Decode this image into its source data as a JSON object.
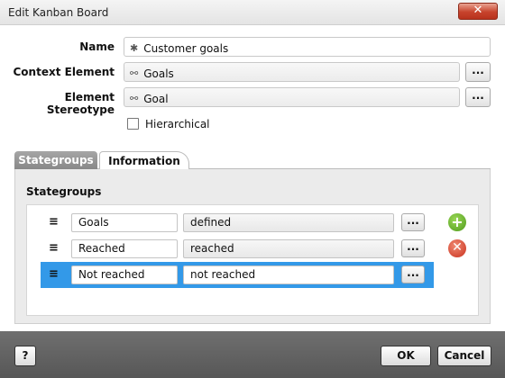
{
  "window": {
    "title": "Edit Kanban Board",
    "close_label": "✕"
  },
  "form": {
    "name_label": "Name",
    "name_value": "Customer goals",
    "name_icon": "asterisk-icon",
    "context_label": "Context Element",
    "context_value": "Goals",
    "stereotype_label": "Element Stereotype",
    "stereotype_value": "Goal",
    "link_icon": "link-icon",
    "browse_label": "...",
    "hierarchical_label": "Hierarchical",
    "hierarchical_checked": false
  },
  "tabs": [
    {
      "label": "Stategroups",
      "active": true
    },
    {
      "label": "Information",
      "active": false
    }
  ],
  "stategroups": {
    "title": "Stategroups",
    "rows": [
      {
        "name": "Goals",
        "state": "defined",
        "selected": false
      },
      {
        "name": "Reached",
        "state": "reached",
        "selected": false
      },
      {
        "name": "Not reached",
        "state": "not reached",
        "selected": true
      }
    ],
    "row_browse_label": "...",
    "drag_glyph": "≡",
    "add_icon": "plus-circle-icon",
    "delete_icon": "x-circle-icon",
    "selection_color": "#3399e8"
  },
  "footer": {
    "help_label": "?",
    "ok_label": "OK",
    "cancel_label": "Cancel"
  }
}
